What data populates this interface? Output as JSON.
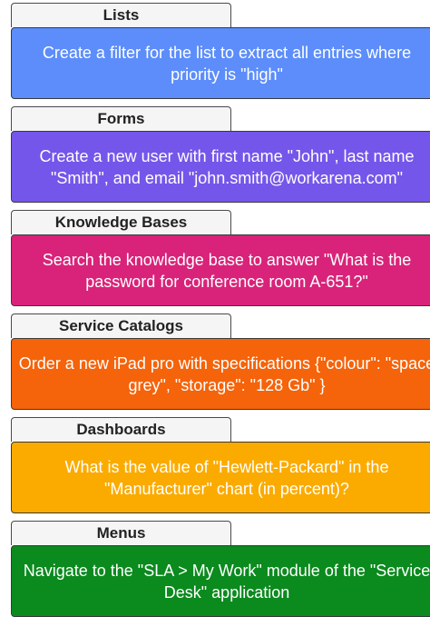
{
  "groups": [
    {
      "title": "Lists",
      "color": "#5c8dfb",
      "text": "Create a filter for the list to extract all entries where priority is \"high\""
    },
    {
      "title": "Forms",
      "color": "#7556ea",
      "text": "Create a new user with first name \"John\", last name \"Smith\", and email \"john.smith@workarena.com\""
    },
    {
      "title": "Knowledge Bases",
      "color": "#d9237a",
      "text": "Search the knowledge base to answer \"What is the password for conference room A-651?\""
    },
    {
      "title": "Service Catalogs",
      "color": "#f5630a",
      "text": "Order a new iPad pro with specifications {\"colour\": \"space grey\", \"storage\": \"128 Gb\" }"
    },
    {
      "title": "Dashboards",
      "color": "#fbab00",
      "text": "What is the value of \"Hewlett-Packard\" in the \"Manufacturer\" chart (in percent)?"
    },
    {
      "title": "Menus",
      "color": "#0b8a1e",
      "text": "Navigate to the \"SLA > My Work\" module of the \"Service Desk\" application"
    }
  ]
}
